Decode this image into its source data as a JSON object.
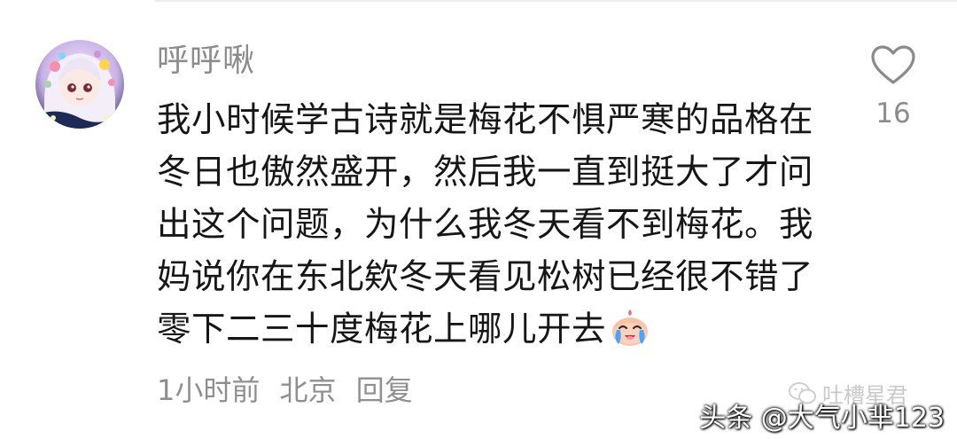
{
  "comment": {
    "username": "呼呼啾",
    "text_lines": [
      "我小时候学古诗就是梅花不惧严寒的品格在",
      "冬日也傲然盛开，然后我一直到挺大了才问",
      "出这个问题，为什么我冬天看不到梅花。我",
      "妈说你在东北欸冬天看见松树已经很不错了",
      "零下二三十度梅花上哪儿开去"
    ],
    "emoji": "crying-face-emoji",
    "time": "1小时前",
    "location": "北京",
    "reply_label": "回复"
  },
  "like": {
    "icon": "heart-icon",
    "count": "16"
  },
  "watermarks": {
    "wechat": "吐槽星君",
    "toutiao": "头条 @大气小芈123"
  },
  "colors": {
    "text_primary": "#161616",
    "text_secondary": "#8c8c8c",
    "background": "#ffffff"
  }
}
